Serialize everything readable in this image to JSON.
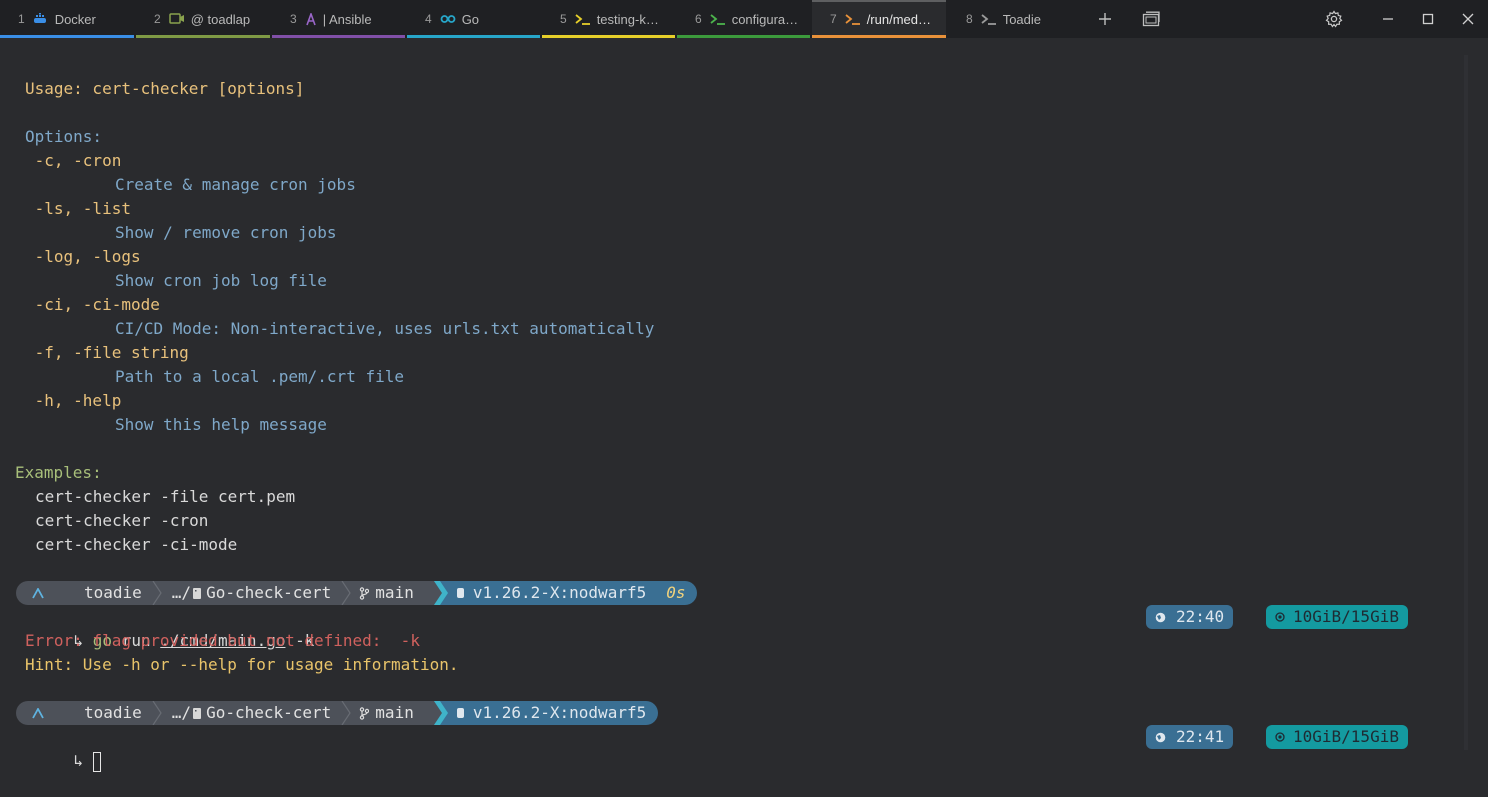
{
  "tabs": [
    {
      "num": "1",
      "label": "Docker",
      "icon": "docker-icon",
      "color": "#3a8ee6"
    },
    {
      "num": "2",
      "label": "@ toadlap",
      "icon": "remote-desktop-icon",
      "color": "#7f9a45"
    },
    {
      "num": "3",
      "label": "| Ansible",
      "icon": "ansible-icon",
      "color": "#8150a8"
    },
    {
      "num": "4",
      "label": "Go",
      "icon": "go-icon",
      "color": "#27a6c9"
    },
    {
      "num": "5",
      "label": "testing-k…",
      "icon": "terminal-icon",
      "color": "#e6cf2a"
    },
    {
      "num": "6",
      "label": "configura…",
      "icon": "terminal-icon",
      "color": "#3c9a3c"
    },
    {
      "num": "7",
      "label": "/run/med…",
      "icon": "terminal-icon",
      "color": "#e8913a",
      "active": true
    },
    {
      "num": "8",
      "label": "Toadie",
      "icon": "terminal-icon",
      "color": "#888888"
    }
  ],
  "terminal": {
    "usage": "Usage: cert-checker [options]",
    "options_header": "Options:",
    "options": [
      {
        "flag": " -c, -cron",
        "desc": "Create & manage cron jobs"
      },
      {
        "flag": " -ls, -list",
        "desc": "Show / remove cron jobs"
      },
      {
        "flag": " -log, -logs",
        "desc": "Show cron job log file"
      },
      {
        "flag": " -ci, -ci-mode",
        "desc": "CI/CD Mode: Non-interactive, uses urls.txt automatically"
      },
      {
        "flag": " -f, -file string",
        "desc": "Path to a local .pem/.crt file"
      },
      {
        "flag": " -h, -help",
        "desc": "Show this help message"
      }
    ],
    "examples_header": "Examples:",
    "examples": [
      "cert-checker -file cert.pem",
      "cert-checker -cron",
      "cert-checker -ci-mode"
    ],
    "prompt1": {
      "user": "toadie",
      "dir": "…/",
      "repo": "Go-check-cert",
      "branch": "main",
      "go_version": "v1.26.2-X:nodwarf5",
      "duration": "0s",
      "command_prefix": "go",
      "command_run": " run ",
      "command_path": "./cmd/main.go",
      "command_args": " -k",
      "time": "22:40",
      "mem": "10GiB/15GiB"
    },
    "error_line": "Error: flag provided but not defined:  -k",
    "hint_line": "Hint: Use -h or --help for usage information.",
    "prompt2": {
      "user": "toadie",
      "dir": "…/",
      "repo": "Go-check-cert",
      "branch": "main",
      "go_version": "v1.26.2-X:nodwarf5",
      "time": "22:41",
      "mem": "10GiB/15GiB"
    }
  },
  "colors": {
    "accent_blue": "#3a6f93",
    "teal": "#149aa0",
    "segment": "#4d5159"
  }
}
